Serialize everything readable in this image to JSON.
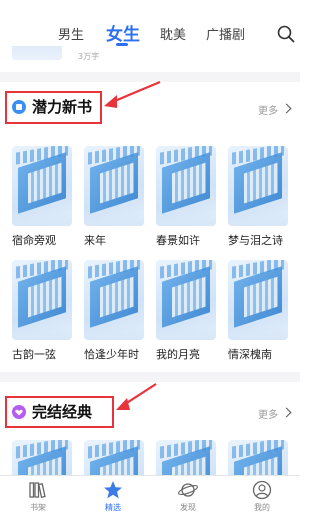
{
  "tabs": [
    {
      "label": "男生",
      "active": false
    },
    {
      "label": "女生",
      "active": true
    },
    {
      "label": "耽美",
      "active": false
    },
    {
      "label": "广播剧",
      "active": false
    }
  ],
  "peek": {
    "subtitle": "3万字"
  },
  "sections": [
    {
      "title": "潜力新书",
      "more_label": "更多",
      "icon_color": "#3c8ff2",
      "books": [
        "宿命旁观",
        "来年",
        "春景如许",
        "梦与泪之诗",
        "古韵一弦",
        "恰逢少年时",
        "我的月亮",
        "情深槐南"
      ]
    },
    {
      "title": "完结经典",
      "more_label": "更多",
      "icon_color": "#b45df0"
    }
  ],
  "bottom_nav": [
    {
      "label": "书架",
      "icon": "bookshelf-icon",
      "active": false
    },
    {
      "label": "精选",
      "icon": "star-icon",
      "active": true
    },
    {
      "label": "发现",
      "icon": "planet-icon",
      "active": false
    },
    {
      "label": "我的",
      "icon": "profile-icon",
      "active": false
    }
  ],
  "colors": {
    "accent": "#2c6ff0",
    "highlight": "#e8333b"
  }
}
